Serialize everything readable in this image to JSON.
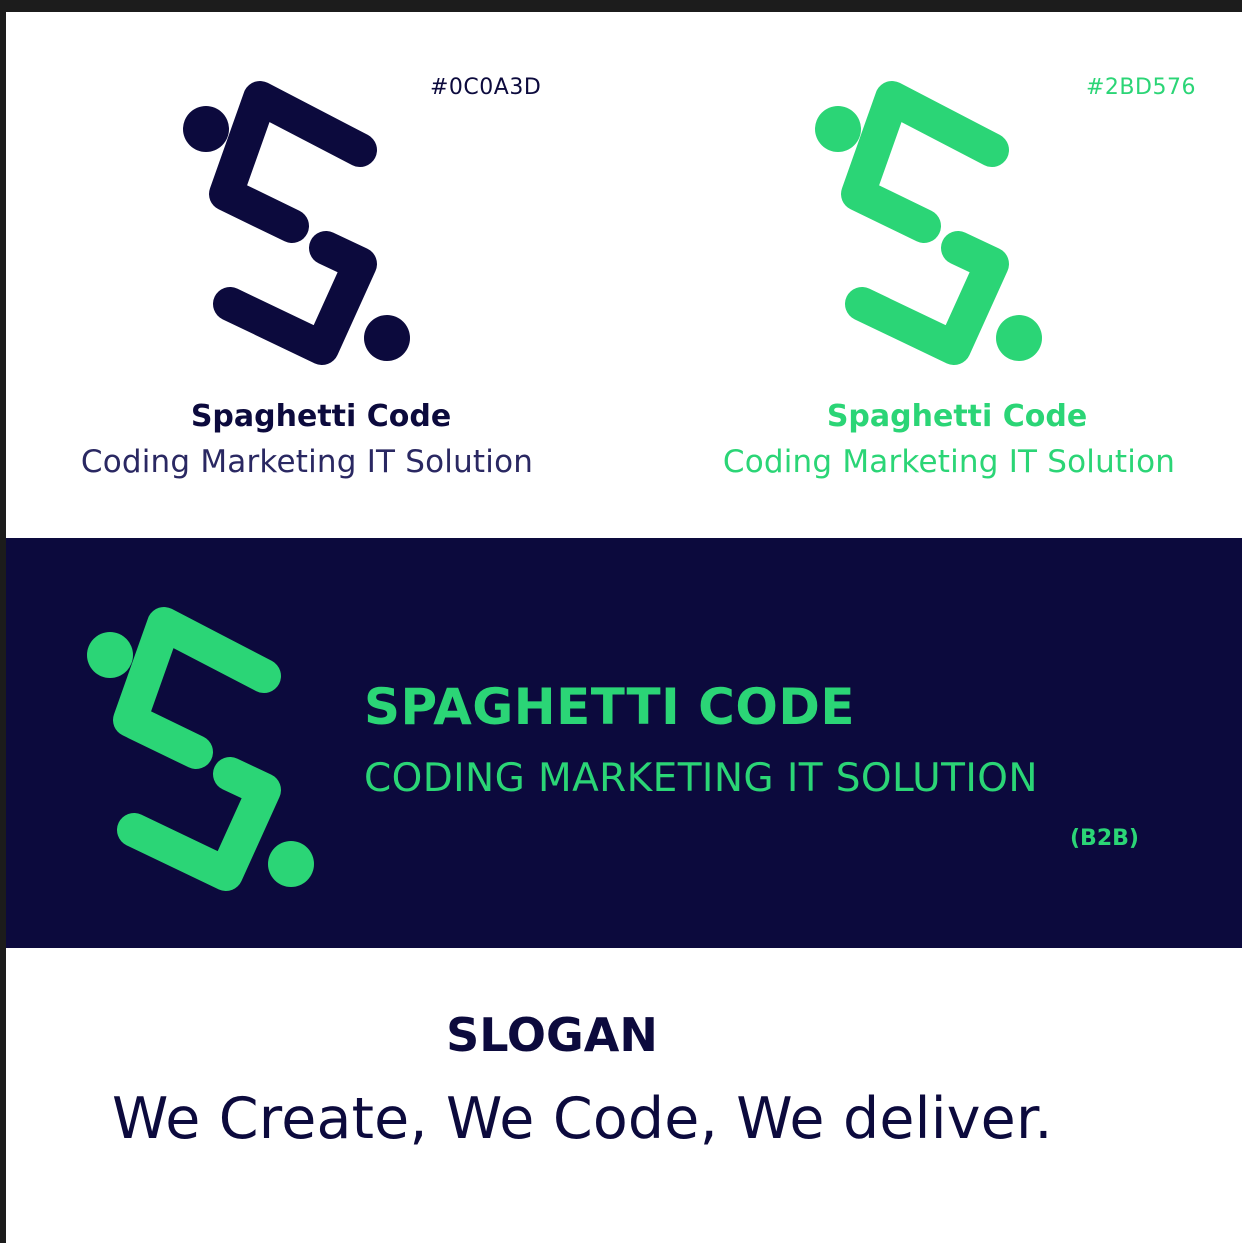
{
  "colors": {
    "navy": "#0C0A3D",
    "green": "#2BD576",
    "white": "#FFFFFF"
  },
  "logos": [
    {
      "hex": "#0C0A3D",
      "name": "Spaghetti Code",
      "tagline": "Coding Marketing IT Solution",
      "color": "#0C0A3D"
    },
    {
      "hex": "#2BD576",
      "name": "Spaghetti Code",
      "tagline": "Coding Marketing IT Solution",
      "color": "#2BD576"
    }
  ],
  "banner": {
    "title": "SPAGHETTI CODE",
    "subtitle": "CODING MARKETING IT SOLUTION",
    "badge": "(B2B)",
    "background": "#0C0A3D",
    "foreground": "#2BD576"
  },
  "slogan": {
    "heading": "SLOGAN",
    "text": "We Create, We Code, We deliver."
  }
}
